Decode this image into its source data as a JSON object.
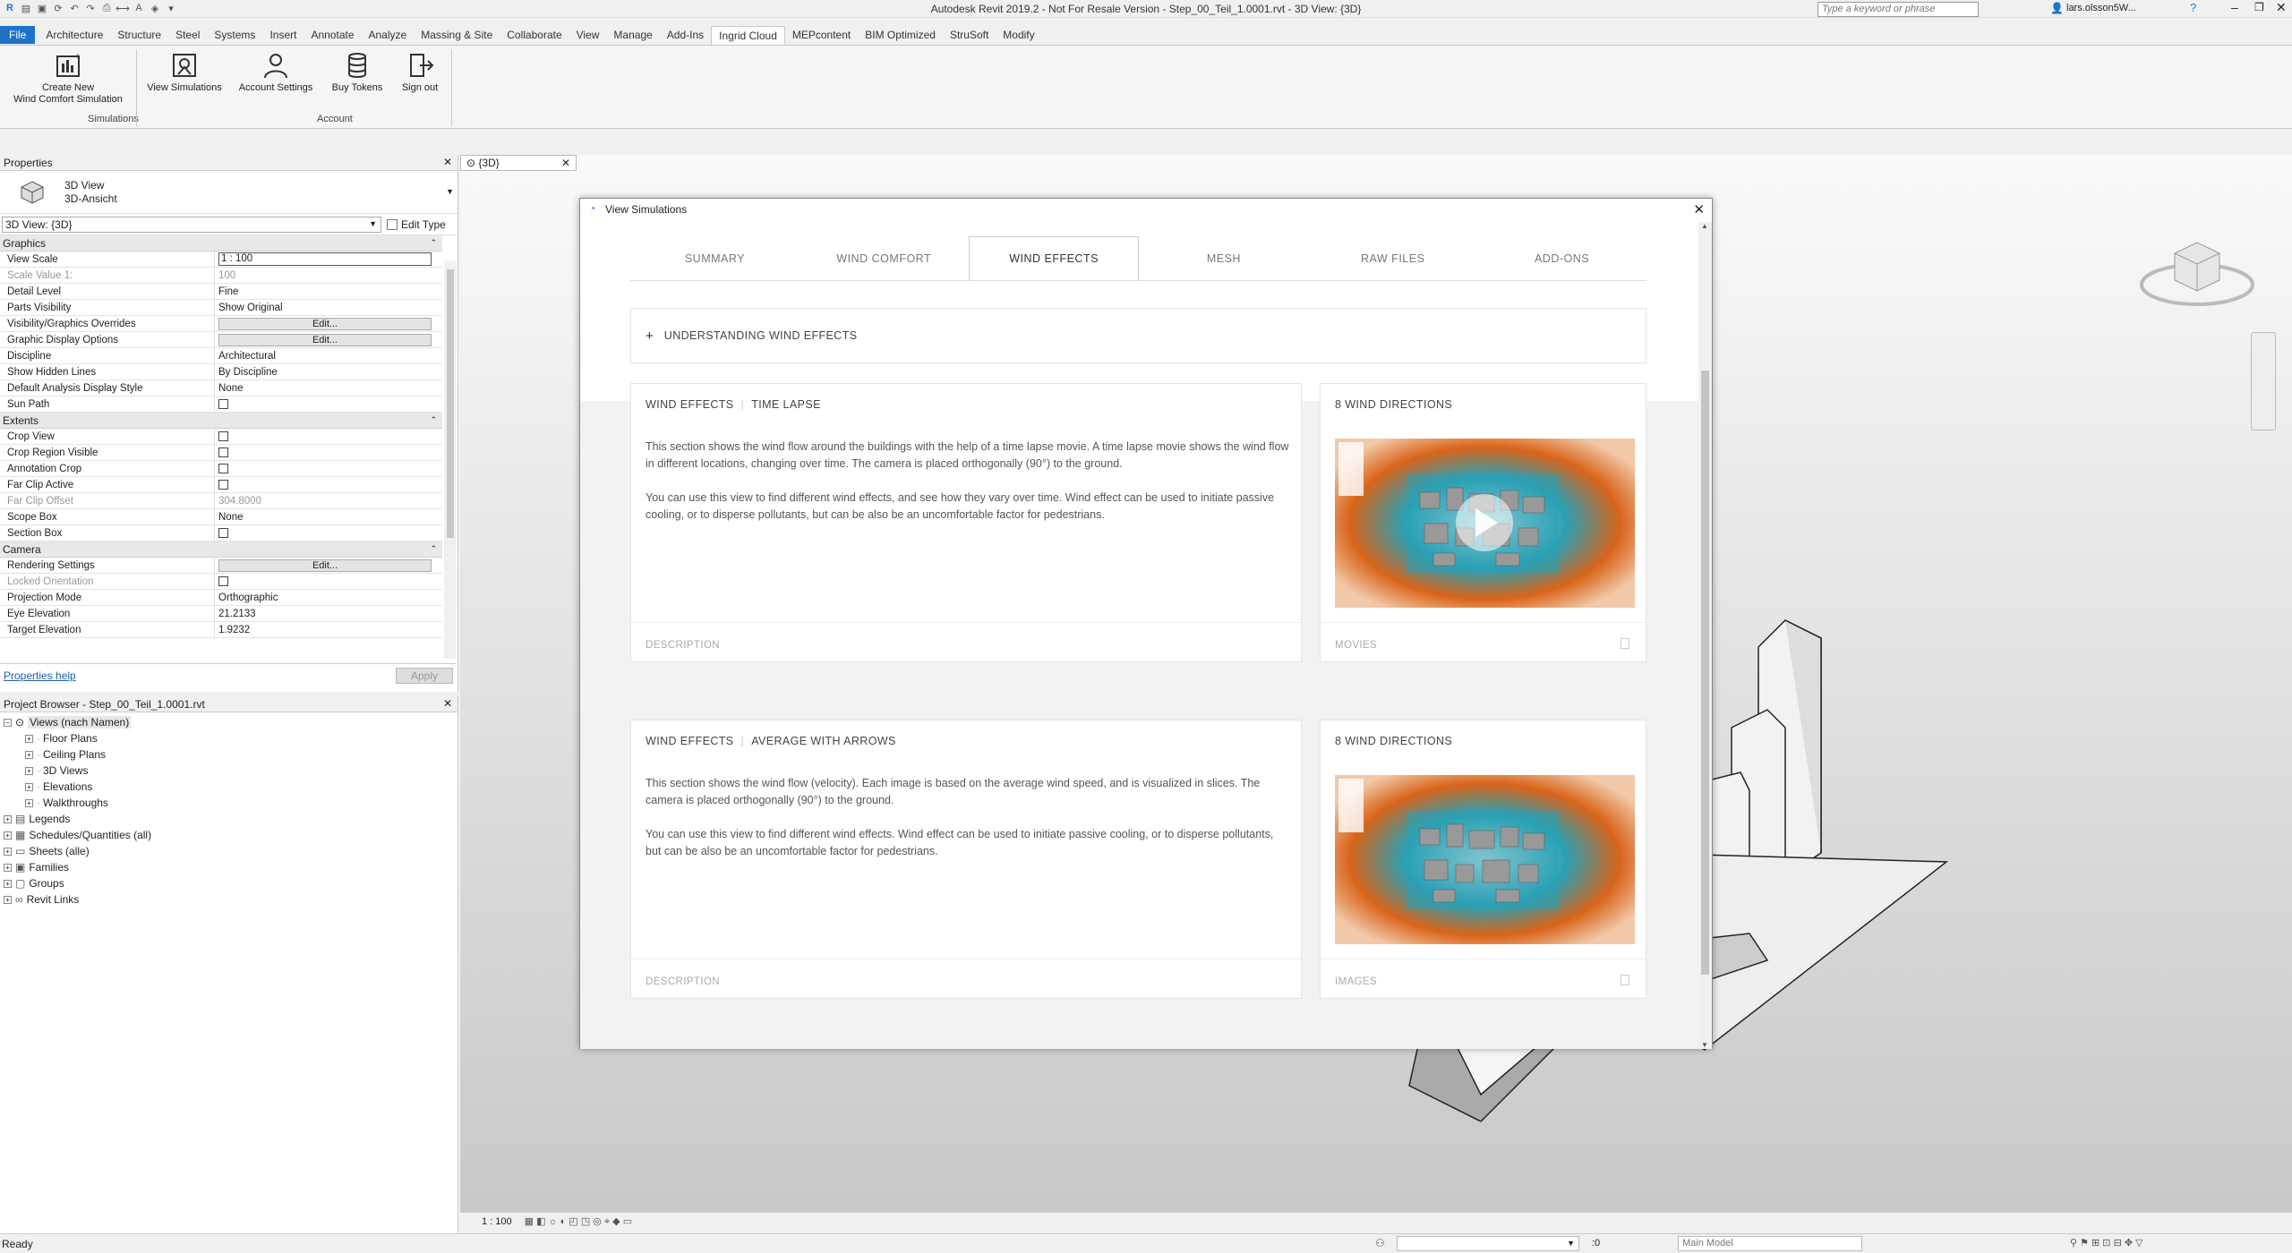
{
  "window": {
    "title": "Autodesk Revit 2019.2 - Not For Resale Version - Step_00_Teil_1.0001.rvt - 3D View: {3D}",
    "search_placeholder": "Type a keyword or phrase",
    "user": "lars.olsson5W..."
  },
  "ribbon": {
    "tabs": [
      "File",
      "Architecture",
      "Structure",
      "Steel",
      "Systems",
      "Insert",
      "Annotate",
      "Analyze",
      "Massing & Site",
      "Collaborate",
      "View",
      "Manage",
      "Add-Ins",
      "Ingrid Cloud",
      "MEPcontent",
      "BIM Optimized",
      "StruSoft",
      "Modify"
    ],
    "active_tab": "Ingrid Cloud",
    "buttons": {
      "create_line1": "Create New",
      "create_line2": "Wind Comfort Simulation",
      "view_simulations": "View Simulations",
      "account_settings": "Account Settings",
      "buy_tokens": "Buy Tokens",
      "sign_out": "Sign out"
    },
    "panels": {
      "simulations": "Simulations",
      "account": "Account"
    }
  },
  "properties": {
    "title": "Properties",
    "type_line1": "3D View",
    "type_line2": "3D-Ansicht",
    "selector": "3D View: {3D}",
    "edit_type": "Edit Type",
    "groups": {
      "graphics": "Graphics",
      "extents": "Extents",
      "camera": "Camera"
    },
    "graphics": [
      {
        "k": "View Scale",
        "v": "1 : 100"
      },
      {
        "k": "Scale Value    1:",
        "v": "100"
      },
      {
        "k": "Detail Level",
        "v": "Fine"
      },
      {
        "k": "Parts Visibility",
        "v": "Show Original"
      },
      {
        "k": "Visibility/Graphics Overrides",
        "v": "Edit..."
      },
      {
        "k": "Graphic Display Options",
        "v": "Edit..."
      },
      {
        "k": "Discipline",
        "v": "Architectural"
      },
      {
        "k": "Show Hidden Lines",
        "v": "By Discipline"
      },
      {
        "k": "Default Analysis Display Style",
        "v": "None"
      },
      {
        "k": "Sun Path",
        "v": ""
      }
    ],
    "extents": [
      {
        "k": "Crop View",
        "v": ""
      },
      {
        "k": "Crop Region Visible",
        "v": ""
      },
      {
        "k": "Annotation Crop",
        "v": ""
      },
      {
        "k": "Far Clip Active",
        "v": ""
      },
      {
        "k": "Far Clip Offset",
        "v": "304.8000"
      },
      {
        "k": "Scope Box",
        "v": "None"
      },
      {
        "k": "Section Box",
        "v": ""
      }
    ],
    "camera": [
      {
        "k": "Rendering Settings",
        "v": "Edit..."
      },
      {
        "k": "Locked Orientation",
        "v": ""
      },
      {
        "k": "Projection Mode",
        "v": "Orthographic"
      },
      {
        "k": "Eye Elevation",
        "v": "21.2133"
      },
      {
        "k": "Target Elevation",
        "v": "1.9232"
      }
    ],
    "help": "Properties help",
    "apply": "Apply"
  },
  "browser": {
    "title": "Project Browser - Step_00_Teil_1.0001.rvt",
    "root": "Views (nach Namen)",
    "views": [
      "Floor Plans",
      "Ceiling Plans",
      "3D Views",
      "Elevations",
      "Walkthroughs"
    ],
    "others": [
      "Legends",
      "Schedules/Quantities (all)",
      "Sheets (alle)",
      "Families",
      "Groups",
      "Revit Links"
    ]
  },
  "view": {
    "tab": "{3D}",
    "scale": "1 : 100"
  },
  "status": {
    "text": "Ready",
    "model": "Main Model",
    "filter": ":0"
  },
  "modal": {
    "title": "View Simulations",
    "tabs": [
      "SUMMARY",
      "WIND COMFORT",
      "WIND EFFECTS",
      "MESH",
      "RAW FILES",
      "ADD-ONS"
    ],
    "active_tab": "WIND EFFECTS",
    "accordion": "UNDERSTANDING WIND EFFECTS",
    "sections": [
      {
        "title_a": "WIND EFFECTS",
        "title_b": "TIME LAPSE",
        "p1": "This section shows the wind flow around the buildings with the help of a time lapse movie. A time lapse movie shows the wind flow in different locations, changing over time. The camera is placed orthogonally (90°) to the ground.",
        "p2": "You can use this view to find different wind effects, and see how they vary over time. Wind effect can be used to initiate passive cooling, or to disperse pollutants, but can be also be an uncomfortable factor for pedestrians.",
        "foot": "DESCRIPTION",
        "media_title": "8 WIND DIRECTIONS",
        "media_foot": "MOVIES"
      },
      {
        "title_a": "WIND EFFECTS",
        "title_b": "AVERAGE WITH ARROWS",
        "p1": "This section shows the wind flow (velocity). Each image is based on the average wind speed, and is visualized in slices. The camera is placed orthogonally (90°) to the ground.",
        "p2": "You can use this view to find different wind effects. Wind effect can be used to initiate passive cooling, or to disperse pollutants, but can be also be an uncomfortable factor for pedestrians.",
        "foot": "DESCRIPTION",
        "media_title": "8 WIND DIRECTIONS",
        "media_foot": "IMAGES"
      }
    ]
  },
  "colors": {
    "accent": "#1e73c8",
    "wind_orange": "#d9641a",
    "wind_teal": "#2aa0b4"
  }
}
